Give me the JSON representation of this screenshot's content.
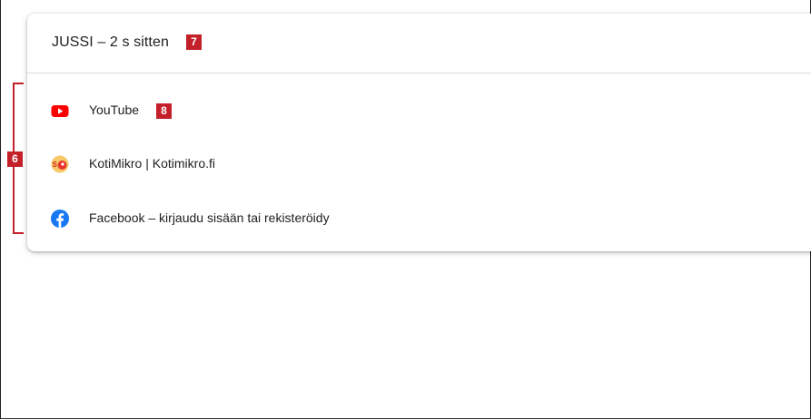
{
  "device": {
    "title": "JUSSI – 2 s sitten"
  },
  "tabs": [
    {
      "label": "YouTube",
      "icon": "youtube-icon"
    },
    {
      "label": "KotiMikro | Kotimikro.fi",
      "icon": "kotimikro-icon"
    },
    {
      "label": "Facebook – kirjaudu sisään tai rekisteröidy",
      "icon": "facebook-icon"
    }
  ],
  "annotations": {
    "group_badge": "6",
    "header_badge": "7",
    "item_badge": "8"
  },
  "colors": {
    "badge": "#c3202a",
    "youtube": "#ff0000",
    "facebook": "#1877f2",
    "text": "#202124",
    "divider": "#dadce0"
  }
}
